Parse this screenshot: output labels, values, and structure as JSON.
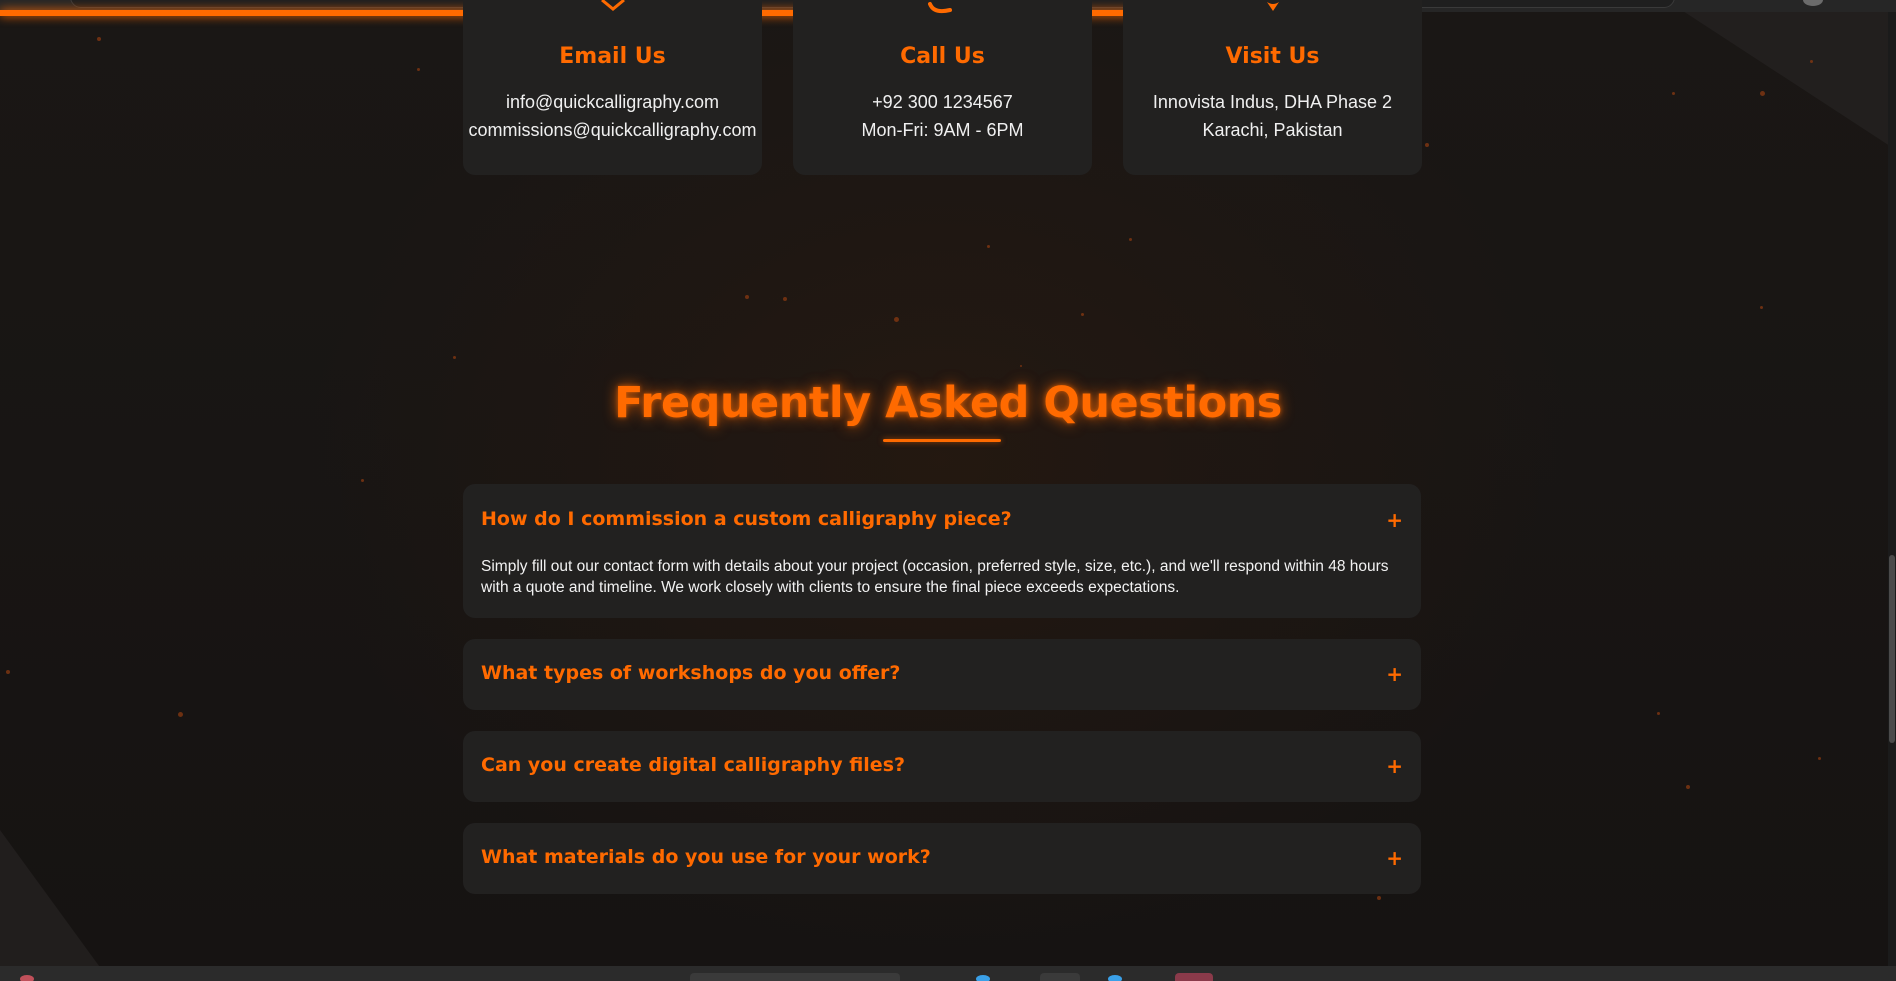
{
  "contact": {
    "email": {
      "title": "Email Us",
      "lines": [
        "info@quickcalligraphy.com",
        "commissions@quickcalligraphy.com"
      ],
      "icon": "envelope-icon"
    },
    "call": {
      "title": "Call Us",
      "lines": [
        "+92 300 1234567",
        "Mon-Fri: 9AM - 6PM"
      ],
      "icon": "phone-icon"
    },
    "visit": {
      "title": "Visit Us",
      "lines": [
        "Innovista Indus, DHA Phase 2",
        "Karachi, Pakistan"
      ],
      "icon": "map-pin-icon"
    }
  },
  "faq": {
    "title": "Frequently Asked Questions",
    "toggle_symbol": "+",
    "items": [
      {
        "question": "How do I commission a custom calligraphy piece?",
        "answer": "Simply fill out our contact form with details about your project (occasion, preferred style, size, etc.), and we'll respond within 48 hours with a quote and timeline. We work closely with clients to ensure the final piece exceeds expectations.",
        "expanded": true
      },
      {
        "question": "What types of workshops do you offer?",
        "expanded": false
      },
      {
        "question": "Can you create digital calligraphy files?",
        "expanded": false
      },
      {
        "question": "What materials do you use for your work?",
        "expanded": false
      }
    ]
  },
  "colors": {
    "accent": "#ff6a00",
    "background": "#171412",
    "card": "#222120",
    "text": "#f0f0f0"
  }
}
